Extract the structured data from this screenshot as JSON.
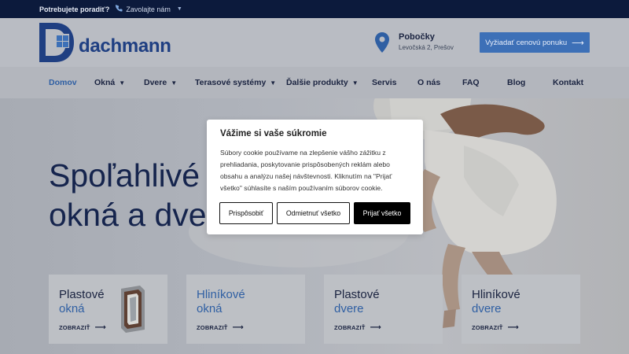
{
  "topbar": {
    "question": "Potrebujete poradiť?",
    "call_label": "Zavolajte nám"
  },
  "header": {
    "logo_text": "dachmann",
    "branch_title": "Pobočky",
    "branch_address": "Levočská 2, Prešov",
    "quote_button": "Vyžiadať cenovú ponuku"
  },
  "nav": {
    "items": [
      {
        "label": "Domov",
        "active": true
      },
      {
        "label": "Okná",
        "dropdown": true
      },
      {
        "label": "Dvere",
        "dropdown": true
      },
      {
        "label": "Terasové systémy",
        "dropdown": true
      },
      {
        "label": "Ďalšie produkty",
        "dropdown": true
      },
      {
        "label": "Servis"
      },
      {
        "label": "O nás"
      },
      {
        "label": "FAQ"
      },
      {
        "label": "Blog"
      },
      {
        "label": "Kontakt"
      }
    ]
  },
  "hero": {
    "title_line1": "Spoľahlivé",
    "title_line2": "okná a dve"
  },
  "cards": [
    {
      "line1": "Plastové",
      "line2": "okná",
      "cta": "ZOBRAZIŤ"
    },
    {
      "line1": "Hliníkové",
      "line2": "okná",
      "cta": "ZOBRAZIŤ"
    },
    {
      "line1": "Plastové",
      "line2": "dvere",
      "cta": "ZOBRAZIŤ"
    },
    {
      "line1": "Hliníkové",
      "line2": "dvere",
      "cta": "ZOBRAZIŤ"
    }
  ],
  "cookie": {
    "title": "Vážime si vaše súkromie",
    "text": "Súbory cookie používame na zlepšenie vášho zážitku z prehliadania, poskytovanie prispôsobených reklám alebo obsahu a analýzu našej návštevnosti. Kliknutím na \"Prijať všetko\" súhlasíte s naším používaním súborov cookie.",
    "customize": "Prispôsobiť",
    "reject": "Odmietnuť všetko",
    "accept": "Prijať všetko"
  },
  "colors": {
    "topbar_bg": "#0c1a3c",
    "brand_blue": "#1f3f82",
    "accent_blue": "#3d70b7",
    "accept_button": "#000000"
  },
  "icons": {
    "phone": "phone-icon",
    "location": "map-pin-icon",
    "arrow": "arrow-right-icon",
    "caret": "caret-down-icon"
  }
}
